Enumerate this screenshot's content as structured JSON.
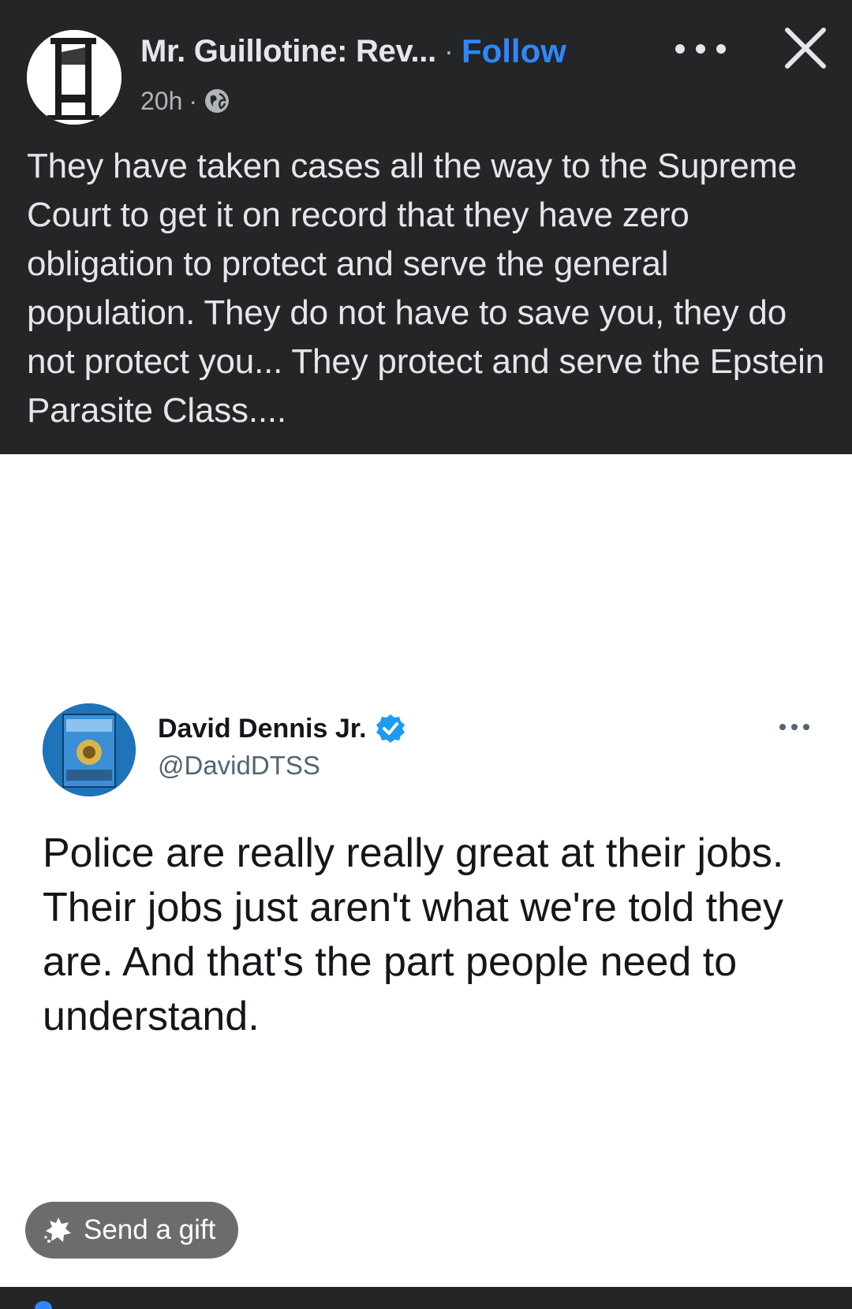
{
  "post": {
    "author_name": "Mr. Guillotine: Rev...",
    "separator": "·",
    "follow_label": "Follow",
    "timestamp": "20h",
    "meta_separator": "·",
    "audience_icon": "globe-icon",
    "text": "They have taken cases all the way to the Supreme Court to get it on record that they have zero obligation to protect and serve the general population. They do not have to save you, they do not protect you... They protect and serve the Epstein Parasite Class...."
  },
  "tweet": {
    "name": "David Dennis Jr.",
    "handle": "@DavidDTSS",
    "verified": true,
    "text": "Police are really really great at their jobs. Their jobs just aren't what we're told they are. And that's the part people need to understand."
  },
  "gift": {
    "label": "Send a gift",
    "icon": "gift-icon"
  },
  "colors": {
    "dark_background": "#242526",
    "accent": "#2d88ff",
    "verified_badge": "#1d9bf0",
    "gift_button": "#6b6c6e"
  }
}
